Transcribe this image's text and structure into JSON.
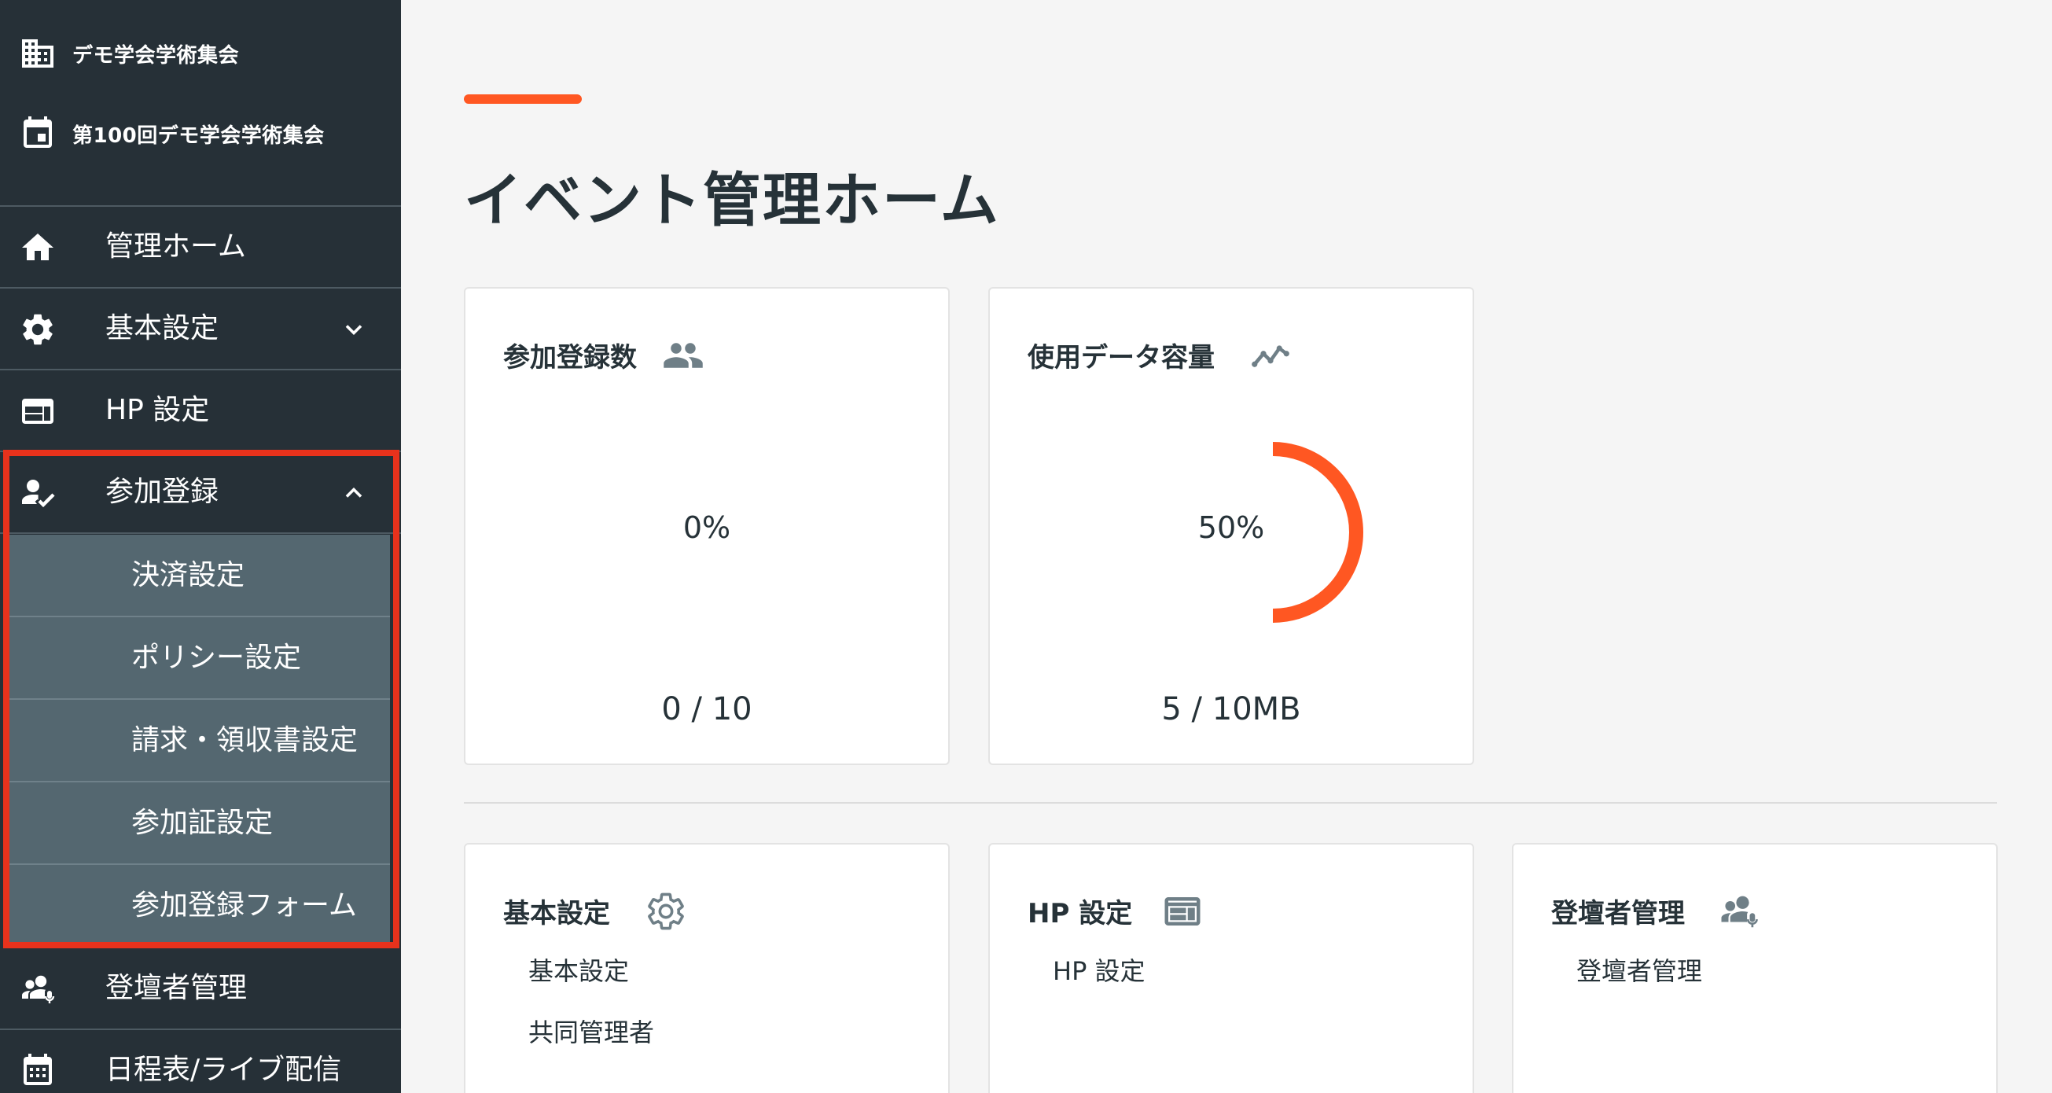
{
  "sidebar": {
    "org_name": "デモ学会学術集会",
    "event_name": "第100回デモ学会学術集会",
    "items": [
      {
        "label": "管理ホーム"
      },
      {
        "label": "基本設定"
      },
      {
        "label": "HP 設定"
      },
      {
        "label": "参加登録"
      },
      {
        "label": "登壇者管理"
      },
      {
        "label": "日程表/ライブ配信"
      }
    ],
    "sub_items": [
      {
        "label": "決済設定"
      },
      {
        "label": "ポリシー設定"
      },
      {
        "label": "請求・領収書設定"
      },
      {
        "label": "参加証設定"
      },
      {
        "label": "参加登録フォーム"
      }
    ]
  },
  "main": {
    "title": "イベント管理ホーム",
    "stats": [
      {
        "title": "参加登録数",
        "percent_label": "0%",
        "count_label": "0 / 10",
        "fraction": 0,
        "icon": "people-icon"
      },
      {
        "title": "使用データ容量",
        "percent_label": "50%",
        "count_label": "5 / 10MB",
        "fraction": 0.5,
        "icon": "trend-icon"
      }
    ],
    "sections": [
      {
        "title": "基本設定",
        "icon": "gear-icon",
        "links": [
          "基本設定",
          "共同管理者"
        ]
      },
      {
        "title": "HP 設定",
        "icon": "web-layout-icon",
        "links": [
          "HP 設定"
        ]
      },
      {
        "title": "登壇者管理",
        "icon": "speaker-group-icon",
        "links": [
          "登壇者管理"
        ]
      }
    ]
  },
  "colors": {
    "sidebar_bg": "#263037",
    "submenu_bg": "#546770",
    "accent": "#ff5722",
    "highlight": "#e8321c"
  }
}
